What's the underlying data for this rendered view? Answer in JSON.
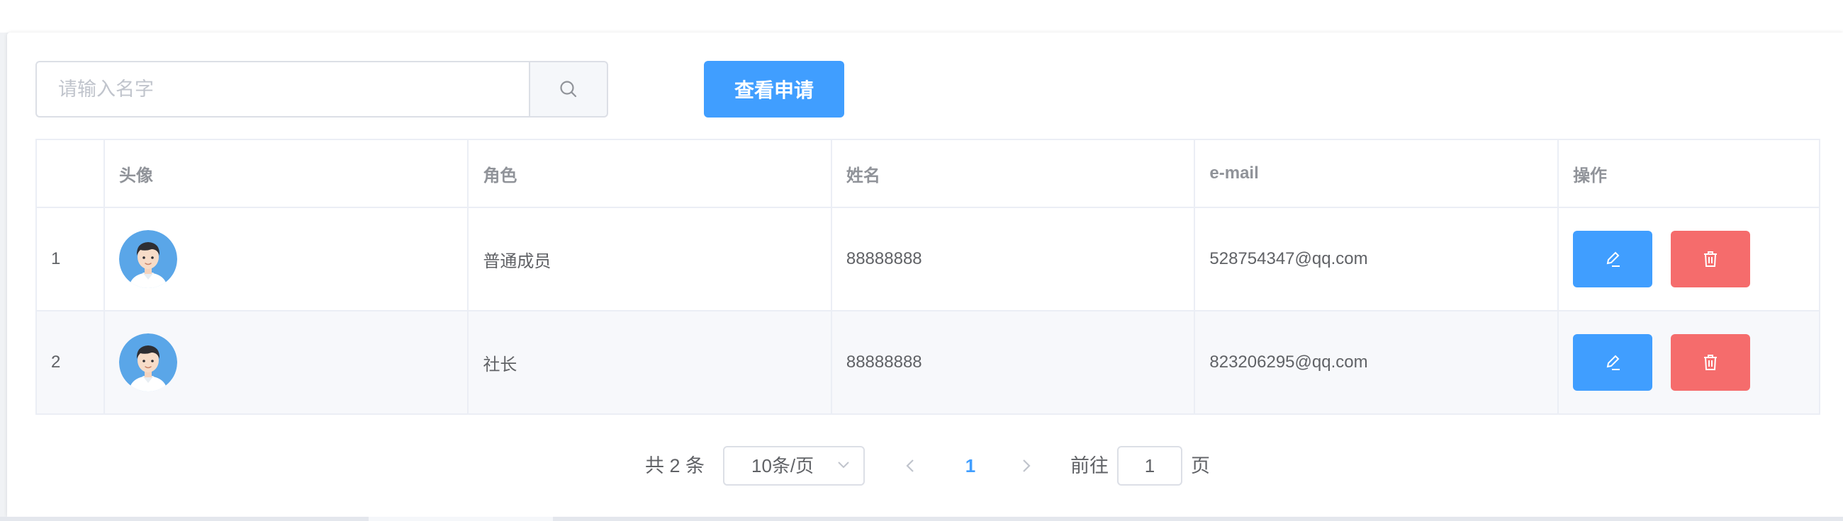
{
  "toolbar": {
    "search_placeholder": "请输入名字",
    "search_value": "",
    "search_icon": "search-icon",
    "view_applications_label": "查看申请"
  },
  "table": {
    "headers": {
      "index": "",
      "avatar": "头像",
      "role": "角色",
      "name": "姓名",
      "email": "e-mail",
      "ops": "操作"
    },
    "rows": [
      {
        "index": "1",
        "avatar": "user-avatar",
        "role": "普通成员",
        "name": "88888888",
        "email": "528754347@qq.com"
      },
      {
        "index": "2",
        "avatar": "user-avatar",
        "role": "社长",
        "name": "88888888",
        "email": "823206295@qq.com"
      }
    ],
    "edit_icon": "edit-icon",
    "delete_icon": "delete-icon"
  },
  "pagination": {
    "total_text": "共 2 条",
    "page_size": "10条/页",
    "current_page": "1",
    "goto_label": "前往",
    "goto_value": "1",
    "goto_suffix": "页"
  },
  "colors": {
    "primary": "#409eff",
    "danger": "#f56c6c",
    "border": "#dcdfe6",
    "table_border": "#ebeef5",
    "header_text": "#909399",
    "body_text": "#606266"
  }
}
